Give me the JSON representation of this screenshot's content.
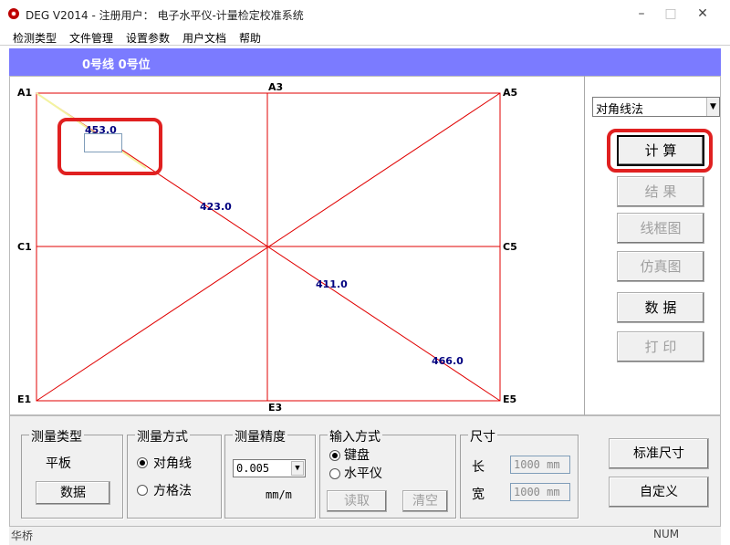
{
  "window": {
    "title": "DEG V2014 - 注册用户： 电子水平仪-计量检定校准系统",
    "minimize": "–",
    "maximize": "□",
    "close": "✕"
  },
  "menu": [
    "检测类型",
    "文件管理",
    "设置参数",
    "用户文档",
    "帮助"
  ],
  "banner": {
    "text": "0号线 0号位"
  },
  "diagram": {
    "corners": {
      "A1": "A1",
      "A3": "A3",
      "A5": "A5",
      "C1": "C1",
      "C5": "C5",
      "E1": "E1",
      "E3": "E3",
      "E5": "E5"
    },
    "values": {
      "top_left": "453.0",
      "upper_mid": "423.0",
      "lower_mid": "411.0",
      "bottom_right": "466.0"
    },
    "line_color": "#e00000"
  },
  "side": {
    "method": "对角线法",
    "buttons": [
      "计 算",
      "结 果",
      "线框图",
      "仿真图",
      "数 据",
      "打 印"
    ]
  },
  "bottom": {
    "type_group": {
      "title": "测量类型",
      "value": "平板",
      "button": "数据"
    },
    "method_group": {
      "title": "测量方式",
      "opt1": "对角线",
      "opt2": "方格法"
    },
    "precision_group": {
      "title": "测量精度",
      "value": "0.005",
      "unit": "mm/m"
    },
    "input_group": {
      "title": "输入方式",
      "opt1": "键盘",
      "opt2": "水平仪",
      "read": "读取",
      "clear": "清空"
    },
    "size_group": {
      "title": "尺寸",
      "len_label": "长",
      "len_value": "1000 mm",
      "wid_label": "宽",
      "wid_value": "1000 mm"
    },
    "std_size": "标准尺寸",
    "custom": "自定义"
  },
  "status": {
    "left": "华桥",
    "right": "NUM"
  },
  "colors": {
    "banner": "#7b7bff",
    "highlight": "#e02020",
    "values": "#00007f"
  }
}
